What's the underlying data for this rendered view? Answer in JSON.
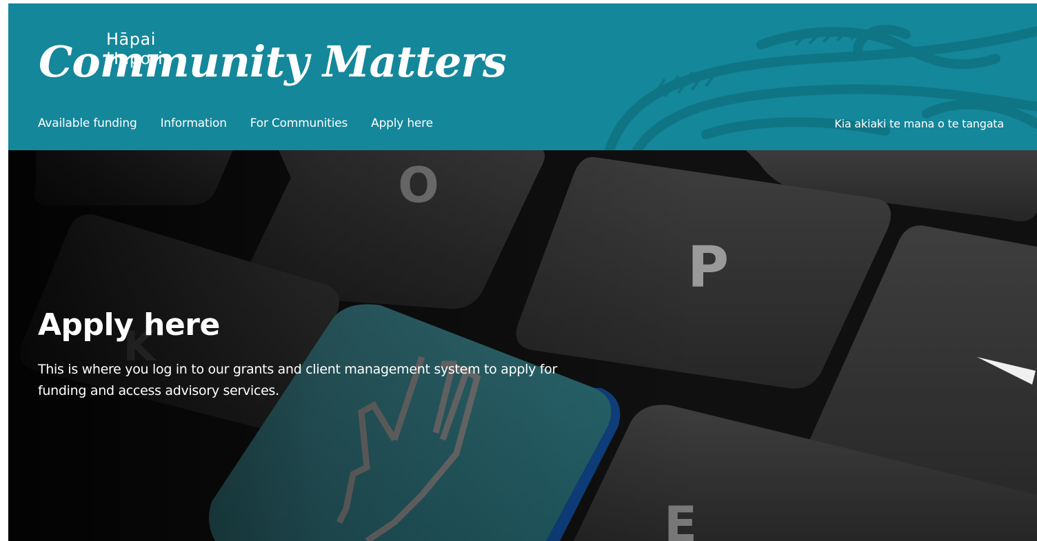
{
  "site": {
    "logo_subtitle": "Hāpai Hapori",
    "logo_title": "Community Matters",
    "tagline": "Kia akiaki te mana o te tangata"
  },
  "nav": {
    "items": [
      {
        "label": "Available funding"
      },
      {
        "label": "Information"
      },
      {
        "label": "For Communities"
      },
      {
        "label": "Apply here"
      }
    ]
  },
  "hero": {
    "title": "Apply here",
    "description": "This is where you log in to our grants and client management system to apply for funding and access advisory services.",
    "key_labels": {
      "o": "O",
      "p": "P",
      "k": "K",
      "e": "E"
    },
    "cursor_icon": "pointing-hand-cursor-icon"
  },
  "colors": {
    "header_bg": "#14879a",
    "key_accent": "#2b6f79",
    "text": "#ffffff"
  }
}
